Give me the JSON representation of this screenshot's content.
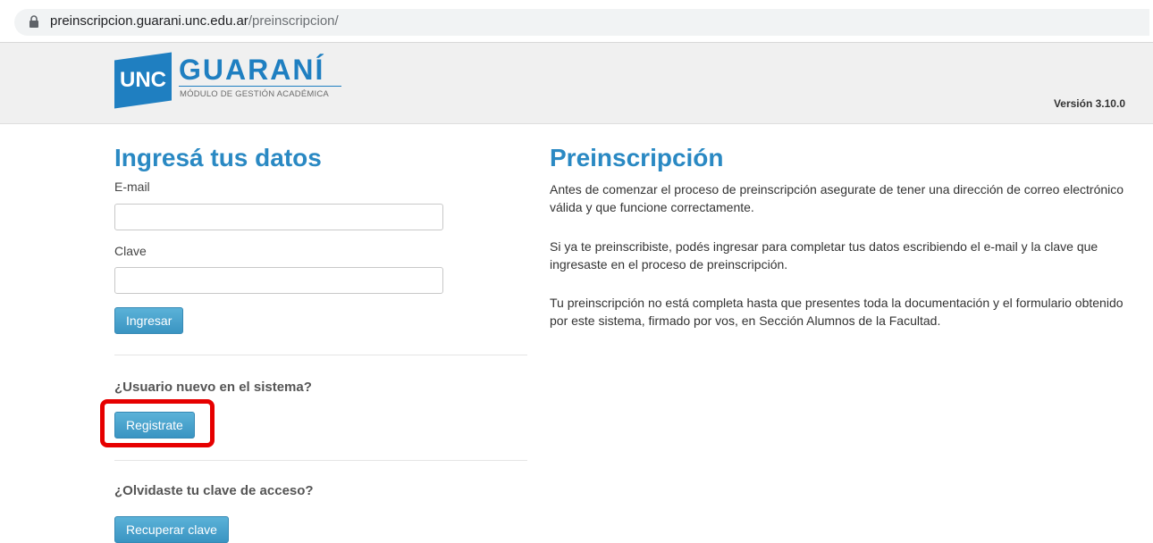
{
  "browser": {
    "url_host": "preinscripcion.guarani.unc.edu.ar",
    "url_path": "/preinscripcion/"
  },
  "header": {
    "logo_unc": "UNC",
    "logo_name": "GUARANÍ",
    "logo_subtitle": "MÓDULO DE GESTIÓN ACADÉMICA",
    "version": "Versión 3.10.0"
  },
  "login": {
    "title": "Ingresá tus datos",
    "email_label": "E-mail",
    "email_value": "",
    "password_label": "Clave",
    "password_value": "",
    "submit_label": "Ingresar"
  },
  "register": {
    "question": "¿Usuario nuevo en el sistema?",
    "button_label": "Registrate"
  },
  "recover": {
    "question": "¿Olvidaste tu clave de acceso?",
    "button_label": "Recuperar clave"
  },
  "info": {
    "title": "Preinscripción",
    "paragraphs": [
      "Antes de comenzar el proceso de preinscripción asegurate de tener una dirección de correo electrónico válida y que funcione correctamente.",
      "Si ya te preinscribiste, podés ingresar para completar tus datos escribiendo el e-mail y la clave que ingresaste en el proceso de preinscripción.",
      "Tu preinscripción no está completa hasta que presentes toda la documentación y el formulario obtenido por este sistema, firmado por vos, en Sección Alumnos de la Facultad."
    ]
  },
  "colors": {
    "accent": "#2a89c3",
    "button": "#3a94c2",
    "highlight": "#e60000"
  }
}
